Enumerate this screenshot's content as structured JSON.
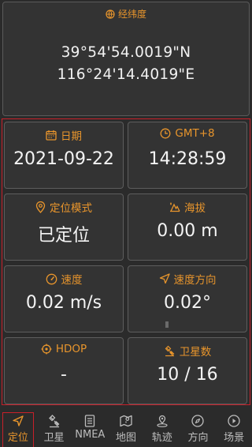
{
  "coords": {
    "title": "经纬度",
    "latitude": "39°54'54.0019\"N",
    "longitude": "116°24'14.4019\"E"
  },
  "cards": {
    "date": {
      "label": "日期",
      "value": "2021-09-22",
      "icon": "calendar-icon"
    },
    "time": {
      "label": "GMT+8",
      "value": "14:28:59",
      "icon": "clock-icon"
    },
    "mode": {
      "label": "定位模式",
      "value": "已定位",
      "icon": "location-pin-icon"
    },
    "altitude": {
      "label": "海拔",
      "value": "0.00 m",
      "icon": "mountain-icon"
    },
    "speed": {
      "label": "速度",
      "value": "0.02 m/s",
      "icon": "speedometer-icon"
    },
    "heading": {
      "label": "速度方向",
      "value": "0.02°",
      "icon": "navigation-arrow-icon"
    },
    "hdop": {
      "label": "HDOP",
      "value": "-",
      "icon": "crosshair-icon"
    },
    "satellites": {
      "label": "卫星数",
      "value": "10 / 16",
      "icon": "satellite-icon"
    }
  },
  "nav": {
    "items": [
      {
        "label": "定位",
        "icon": "navigation-icon",
        "active": true
      },
      {
        "label": "卫星",
        "icon": "satellite-icon",
        "active": false
      },
      {
        "label": "NMEA",
        "icon": "document-icon",
        "active": false
      },
      {
        "label": "地图",
        "icon": "map-icon",
        "active": false
      },
      {
        "label": "轨迹",
        "icon": "track-pin-icon",
        "active": false
      },
      {
        "label": "方向",
        "icon": "compass-icon",
        "active": false
      },
      {
        "label": "场景",
        "icon": "play-circle-icon",
        "active": false
      }
    ]
  },
  "colors": {
    "accent": "#e8952c",
    "highlight_frame": "#c8202a",
    "background": "#2b2b2b",
    "card": "#333333"
  }
}
